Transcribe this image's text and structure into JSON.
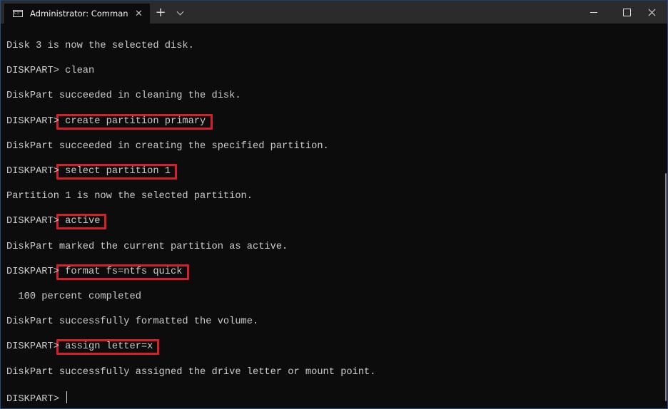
{
  "window": {
    "tab_title": "Administrator: Command Prompt",
    "tab_icon": "command-prompt-icon",
    "new_tab_label": "+",
    "close_tab_label": "✕",
    "controls": {
      "minimize": "minimize-icon",
      "maximize": "maximize-icon",
      "close": "close-icon"
    }
  },
  "console": {
    "prompt": "DISKPART> ",
    "highlight_color": "#d3202a",
    "lines": [
      {
        "type": "output",
        "text": "Disk 3 is now the selected disk."
      },
      {
        "type": "command",
        "prompt": "DISKPART> ",
        "command": "clean",
        "highlighted": false
      },
      {
        "type": "output",
        "text": "DiskPart succeeded in cleaning the disk."
      },
      {
        "type": "command",
        "prompt": "DISKPART> ",
        "command": "create partition primary",
        "highlighted": true
      },
      {
        "type": "output",
        "text": "DiskPart succeeded in creating the specified partition."
      },
      {
        "type": "command",
        "prompt": "DISKPART> ",
        "command": "select partition 1",
        "highlighted": true
      },
      {
        "type": "output",
        "text": "Partition 1 is now the selected partition."
      },
      {
        "type": "command",
        "prompt": "DISKPART> ",
        "command": "active",
        "highlighted": true
      },
      {
        "type": "output",
        "text": "DiskPart marked the current partition as active."
      },
      {
        "type": "command",
        "prompt": "DISKPART> ",
        "command": "format fs=ntfs quick",
        "highlighted": true
      },
      {
        "type": "output",
        "text": "  100 percent completed"
      },
      {
        "type": "output",
        "text": "DiskPart successfully formatted the volume."
      },
      {
        "type": "command",
        "prompt": "DISKPART> ",
        "command": "assign letter=x",
        "highlighted": true
      },
      {
        "type": "output",
        "text": "DiskPart successfully assigned the drive letter or mount point."
      },
      {
        "type": "prompt",
        "prompt": "DISKPART> ",
        "command": ""
      }
    ]
  }
}
